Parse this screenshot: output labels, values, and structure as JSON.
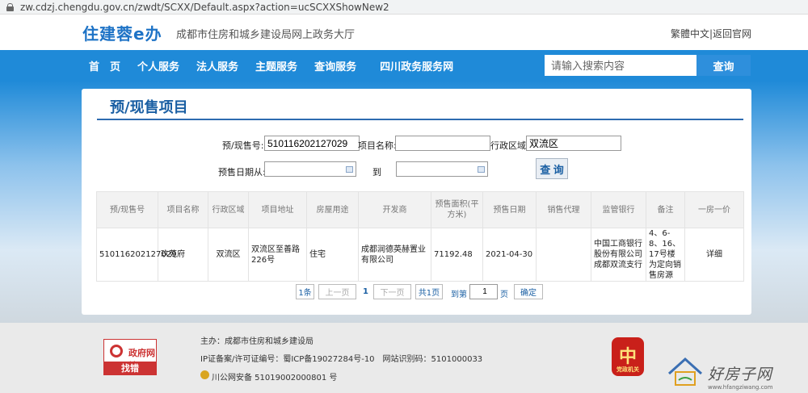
{
  "browser": {
    "url": "zw.cdzj.chengdu.gov.cn/zwdt/SCXX/Default.aspx?action=ucSCXXShowNew2"
  },
  "header": {
    "logo": "住建蓉e办",
    "subtitle": "成都市住房和城乡建设局网上政务大厅",
    "links": "繁體中文|返回官网"
  },
  "nav": {
    "items": [
      "首　页",
      "个人服务",
      "法人服务",
      "主题服务",
      "查询服务",
      "四川政务服务网"
    ],
    "search_placeholder": "请输入搜索内容",
    "search_button": "查询"
  },
  "panel": {
    "title": "预/现售项目",
    "form": {
      "presale_no_label": "预/现售号:",
      "presale_no_value": "510116202127029",
      "project_name_label": "项目名称:",
      "project_name_value": "",
      "district_label": "行政区域:",
      "district_value": "双流区",
      "date_from_label": "预售日期从:",
      "date_to_label": "到",
      "query_button": "查 询"
    },
    "table": {
      "headers": [
        "预/现售号",
        "项目名称",
        "行政区域",
        "项目地址",
        "房屋用途",
        "开发商",
        "预售面积(平方米)",
        "预售日期",
        "销售代理",
        "监管银行",
        "备注",
        "一房一价"
      ],
      "rows": [
        [
          "510116202127029",
          "玖苑府",
          "双流区",
          "双流区至善路226号",
          "住宅",
          "成都润德英赫置业有限公司",
          "71192.48",
          "2021-04-30",
          "",
          "中国工商银行股份有限公司成都双流支行",
          "4、6-8、16、17号楼为定向销售房源",
          "详细"
        ]
      ]
    },
    "pager": {
      "first": "1条",
      "prev": "上一页",
      "current": "1",
      "next": "下一页",
      "total": "共1页",
      "goto_label": "到第",
      "goto_value": "1",
      "page_unit": "页",
      "confirm": "确定"
    }
  },
  "footer": {
    "badge_top": "政府网站",
    "badge_bottom": "找错",
    "host": "主办：成都市住房和城乡建设局",
    "icp": "IP证备案/许可证编号：蜀ICP备19027284号-10　网站识别码：5101000033",
    "police": "川公网安备 51019002000801 号",
    "emblem_text": "党政机关",
    "watermark": "好房子网",
    "watermark_url": "www.hfangziwang.com"
  }
}
